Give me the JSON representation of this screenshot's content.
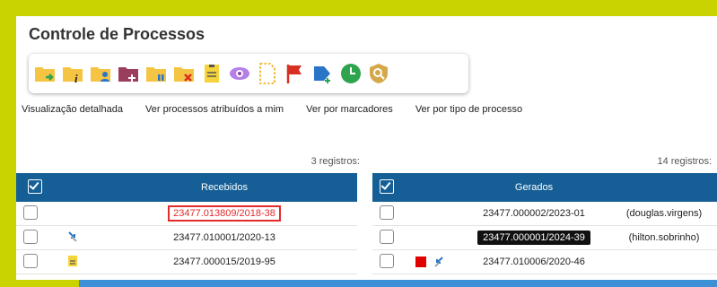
{
  "title": "Controle de Processos",
  "toolbar": {
    "icons": [
      "folder-arrow-icon",
      "folder-info-icon",
      "folder-user-icon",
      "folder-plus-icon",
      "folder-pause-icon",
      "folder-close-icon",
      "note-icon",
      "eye-icon",
      "dashed-document-icon",
      "flag-icon",
      "tag-plus-icon",
      "clock-icon",
      "shield-search-icon"
    ],
    "colors": {
      "folder": "#f5c443",
      "accent_green": "#2ea44f",
      "accent_blue": "#2a75c7",
      "accent_red": "#d93025",
      "accent_purple": "#8e44ad"
    }
  },
  "links": {
    "detailed": "Visualização detalhada",
    "assigned": "Ver processos atribuídos a mim",
    "markers": "Ver por marcadores",
    "type": "Ver por tipo de processo"
  },
  "received": {
    "count": "3 registros:",
    "header": "Recebidos",
    "rows": [
      {
        "process": "23477.013809/2018-38",
        "icon": ""
      },
      {
        "process": "23477.010001/2020-13",
        "icon": "sync-arrows-icon"
      },
      {
        "process": "23477.000015/2019-95",
        "icon": "note-icon"
      }
    ]
  },
  "generated": {
    "count": "14 registros:",
    "header": "Gerados",
    "rows": [
      {
        "process": "23477.000002/2023-01",
        "user": "(douglas.virgens)"
      },
      {
        "process": "23477.000001/2024-39",
        "user": "(hilton.sobrinho)"
      },
      {
        "process": "23477.010006/2020-46",
        "user": ""
      }
    ]
  }
}
